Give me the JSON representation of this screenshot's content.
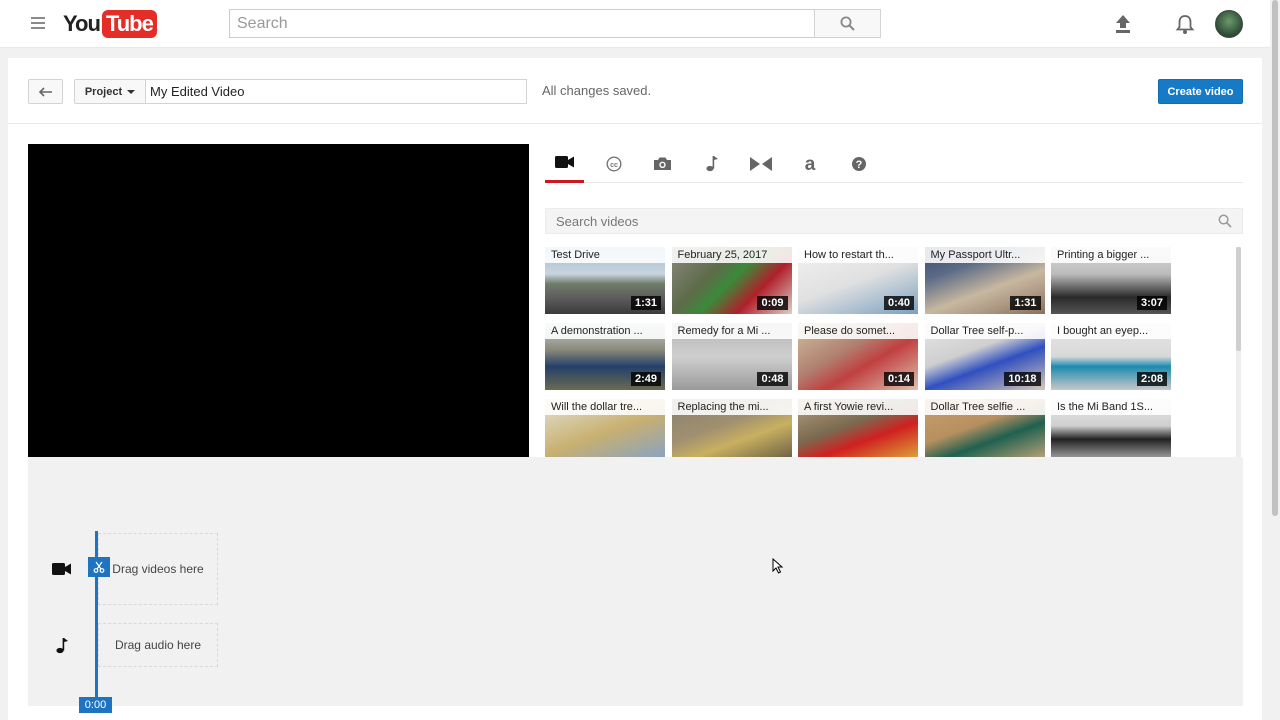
{
  "masthead": {
    "logo_you": "You",
    "logo_tube": "Tube",
    "search_placeholder": "Search",
    "icons": [
      "menu-icon",
      "search-icon",
      "upload-icon",
      "bell-icon",
      "avatar"
    ]
  },
  "editor": {
    "project_label": "Project",
    "title_value": "My Edited Video",
    "status": "All changes saved.",
    "create_label": "Create video"
  },
  "tabs": [
    {
      "icon": "video-camera-icon",
      "active": true
    },
    {
      "icon": "creative-commons-icon",
      "active": false
    },
    {
      "icon": "camera-icon",
      "active": false
    },
    {
      "icon": "music-note-icon",
      "active": false
    },
    {
      "icon": "transitions-icon",
      "active": false
    },
    {
      "icon": "text-icon",
      "active": false
    },
    {
      "icon": "help-icon",
      "active": false
    }
  ],
  "library": {
    "search_placeholder": "Search videos",
    "videos": [
      {
        "title": "Test Drive",
        "duration": "1:31"
      },
      {
        "title": "February 25, 2017",
        "duration": "0:09"
      },
      {
        "title": "How to restart th...",
        "duration": "0:40"
      },
      {
        "title": "My Passport Ultr...",
        "duration": "1:31"
      },
      {
        "title": "Printing a bigger ...",
        "duration": "3:07"
      },
      {
        "title": "A demonstration ...",
        "duration": "2:49"
      },
      {
        "title": "Remedy for a Mi ...",
        "duration": "0:48"
      },
      {
        "title": "Please do somet...",
        "duration": "0:14"
      },
      {
        "title": "Dollar Tree self-p...",
        "duration": "10:18"
      },
      {
        "title": "I bought an eyep...",
        "duration": "2:08"
      },
      {
        "title": "Will the dollar tre...",
        "duration": ""
      },
      {
        "title": "Replacing the mi...",
        "duration": ""
      },
      {
        "title": "A first Yowie revi...",
        "duration": ""
      },
      {
        "title": "Dollar Tree selfie ...",
        "duration": ""
      },
      {
        "title": "Is the Mi Band 1S...",
        "duration": ""
      }
    ]
  },
  "timeline": {
    "video_drop_label": "Drag videos here",
    "audio_drop_label": "Drag audio here",
    "playhead_time": "0:00",
    "accent_color": "#1e74c1"
  },
  "colors": {
    "brand_red": "#e52d27",
    "primary_blue": "#167ac6",
    "tab_indicator": "#cc181e"
  }
}
